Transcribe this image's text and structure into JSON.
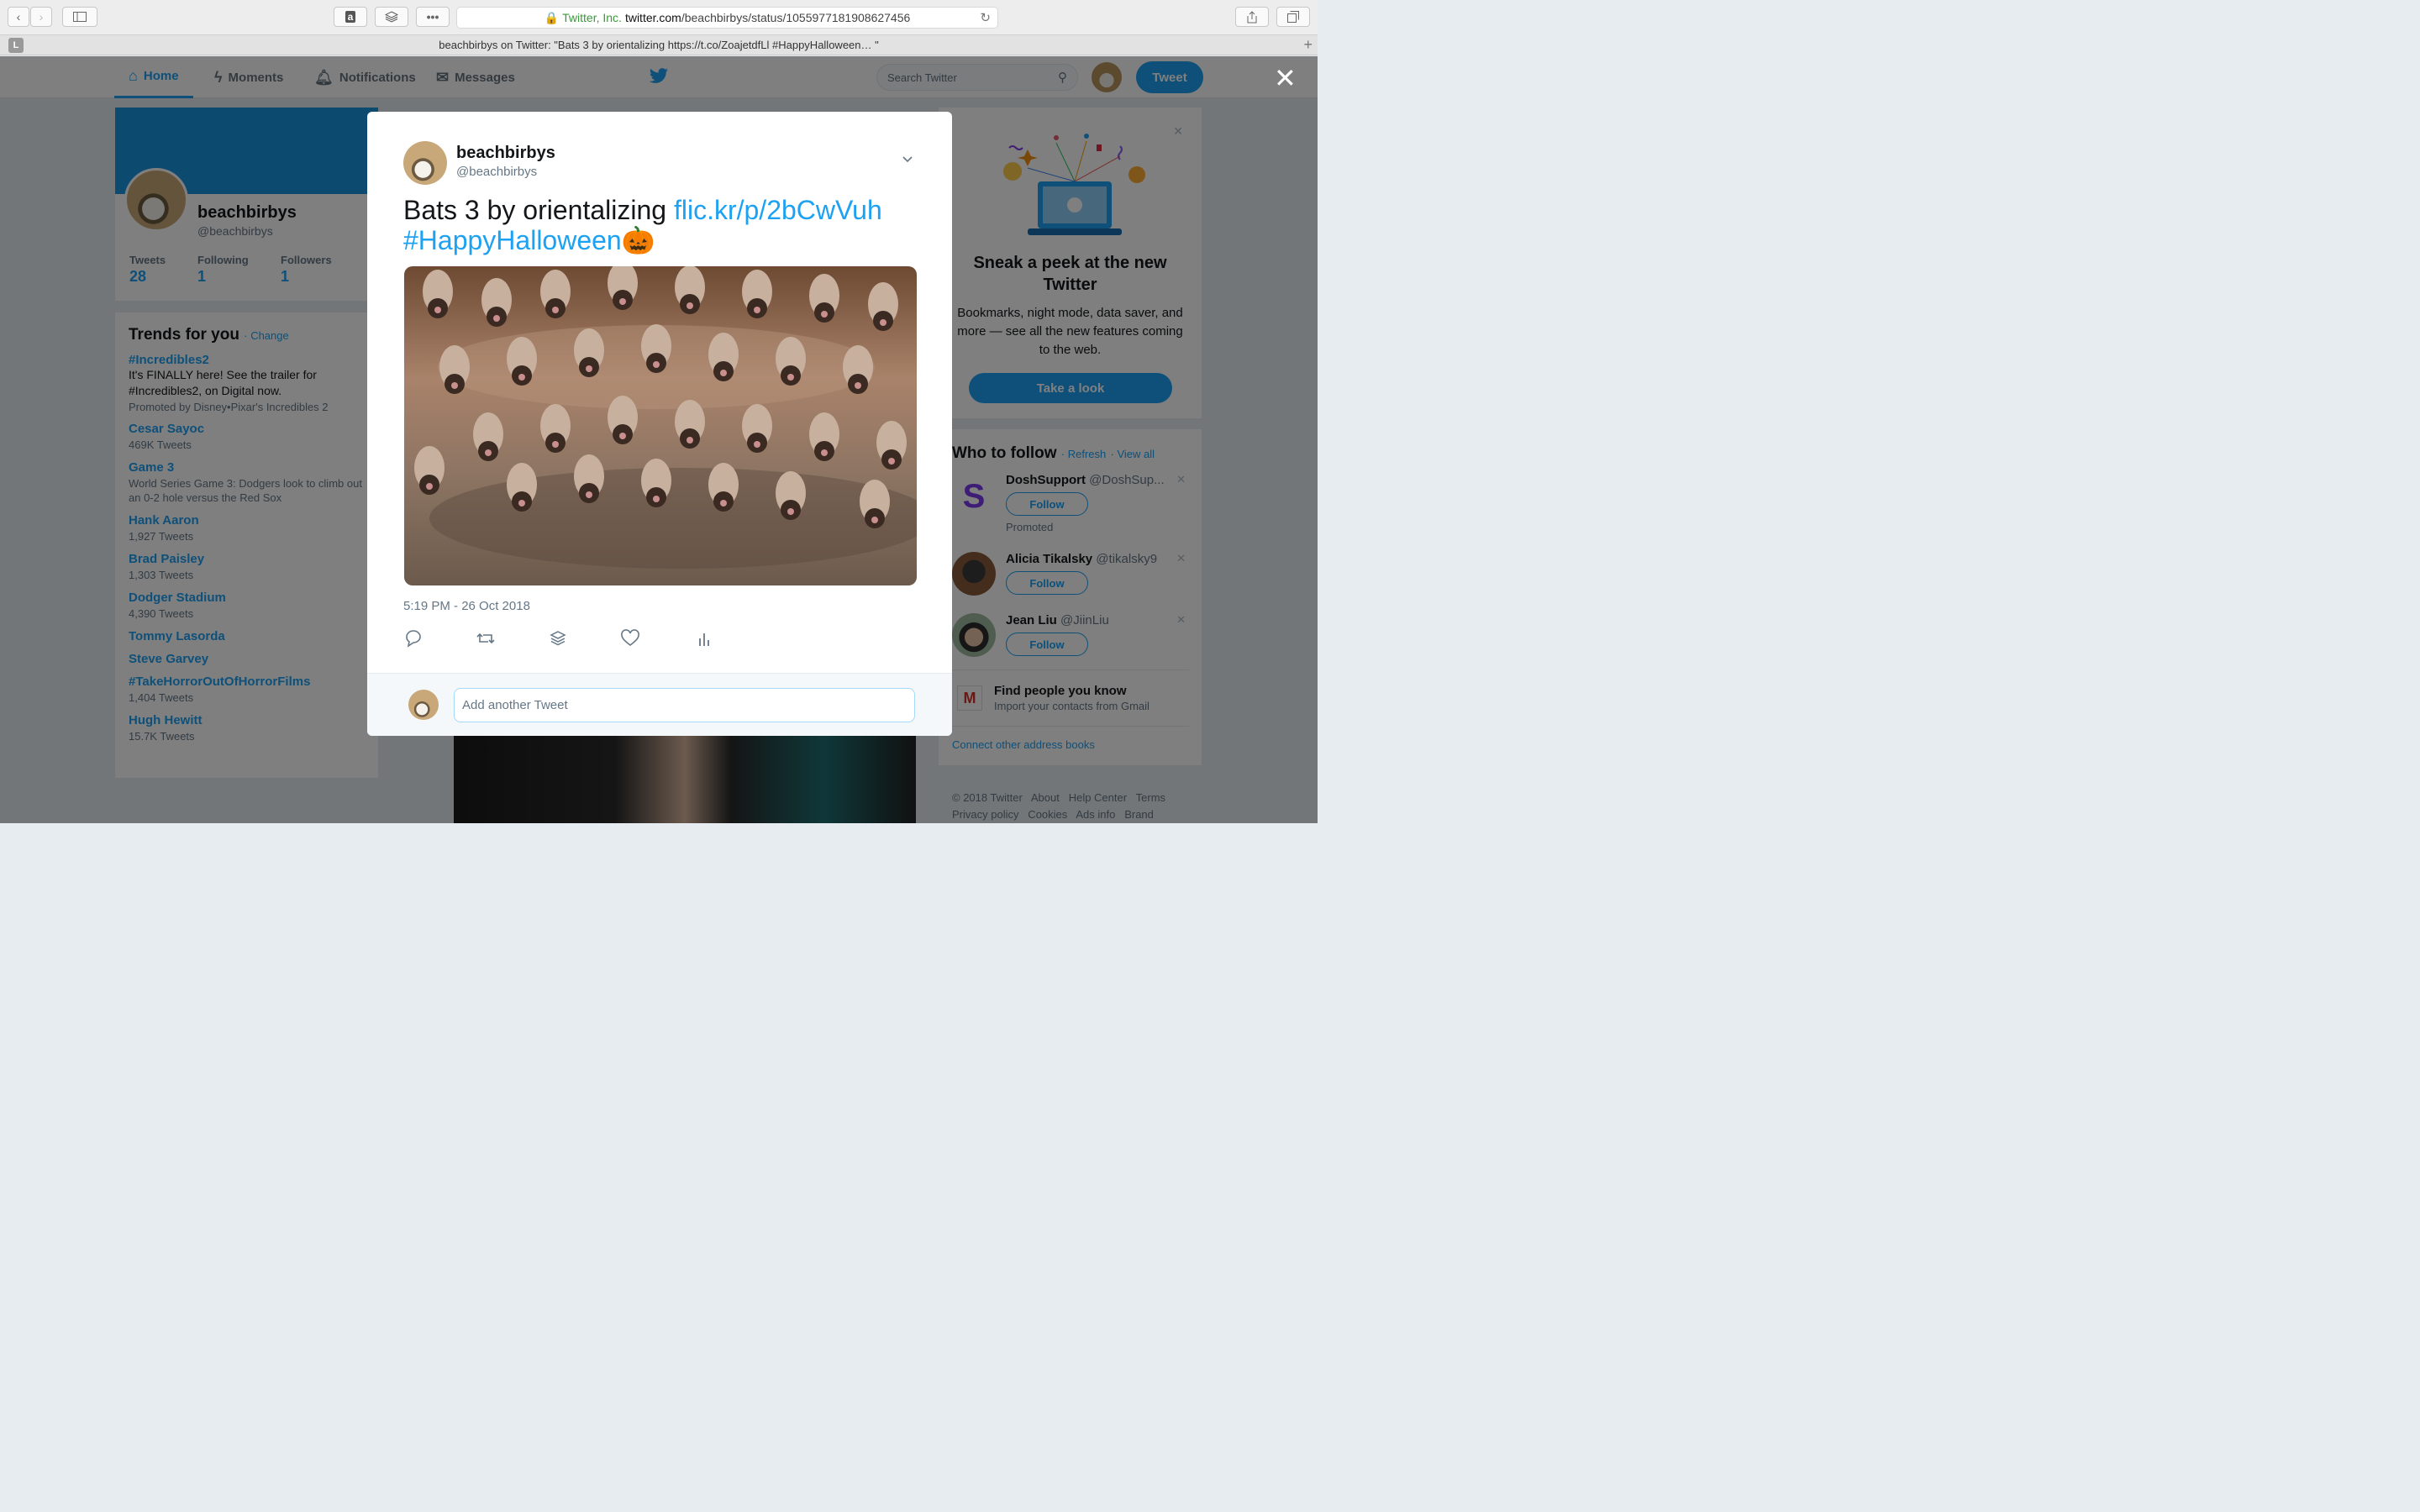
{
  "browser": {
    "url_secure_label": "Twitter, Inc.",
    "url_host": "twitter.com",
    "url_path": "/beachbirbys/status/1055977181908627456",
    "tab_title": "beachbirbys on Twitter: \"Bats 3 by orientalizing https://t.co/ZoajetdfLl #HappyHalloween… \"",
    "tab_badge": "L"
  },
  "nav": {
    "home": "Home",
    "moments": "Moments",
    "notifications": "Notifications",
    "messages": "Messages",
    "search_placeholder": "Search Twitter",
    "tweet_button": "Tweet"
  },
  "profile": {
    "name": "beachbirbys",
    "handle": "@beachbirbys",
    "stats": [
      {
        "label": "Tweets",
        "value": "28"
      },
      {
        "label": "Following",
        "value": "1"
      },
      {
        "label": "Followers",
        "value": "1"
      }
    ]
  },
  "trends": {
    "title": "Trends for you",
    "change_link": "· Change",
    "promoted": {
      "name": "#Incredibles2",
      "text": "It's FINALLY here! See the trailer for #Incredibles2, on Digital now.",
      "by": "Promoted by Disney•Pixar's Incredibles 2"
    },
    "items": [
      {
        "name": "Cesar Sayoc",
        "desc": "469K Tweets"
      },
      {
        "name": "Game 3",
        "desc": "World Series Game 3: Dodgers look to climb out an 0-2 hole versus the Red Sox"
      },
      {
        "name": "Hank Aaron",
        "desc": "1,927 Tweets"
      },
      {
        "name": "Brad Paisley",
        "desc": "1,303 Tweets"
      },
      {
        "name": "Dodger Stadium",
        "desc": "4,390 Tweets"
      },
      {
        "name": "Tommy Lasorda",
        "desc": ""
      },
      {
        "name": "Steve Garvey",
        "desc": ""
      },
      {
        "name": "#TakeHorrorOutOfHorrorFilms",
        "desc": "1,404 Tweets"
      },
      {
        "name": "Hugh Hewitt",
        "desc": "15.7K Tweets"
      }
    ]
  },
  "promo_card": {
    "title": "Sneak a peek at the new Twitter",
    "desc": "Bookmarks, night mode, data saver, and more — see all the new features coming to the web.",
    "button": "Take a look"
  },
  "who_to_follow": {
    "title": "Who to follow",
    "refresh": "· Refresh",
    "view_all": "· View all",
    "users": [
      {
        "name": "DoshSupport",
        "handle": "@DoshSup...",
        "follow": "Follow",
        "note": "Promoted"
      },
      {
        "name": "Alicia Tikalsky",
        "handle": "@tikalsky9",
        "follow": "Follow",
        "note": ""
      },
      {
        "name": "Jean Liu",
        "handle": "@JiinLiu",
        "follow": "Follow",
        "note": ""
      }
    ],
    "gmail_title": "Find people you know",
    "gmail_desc": "Import your contacts from Gmail",
    "connect_link": "Connect other address books"
  },
  "footer": {
    "line1": "© 2018 Twitter   About   Help Center   Terms",
    "line2": "Privacy policy   Cookies   Ads info   Brand"
  },
  "tweet": {
    "name": "beachbirbys",
    "handle": "@beachbirbys",
    "text_prefix": "Bats 3 by orientalizing ",
    "link": "flic.kr/p/2bCwVuh",
    "hashtag": "#HappyHalloween",
    "emoji": "🎃",
    "timestamp": "5:19 PM - 26 Oct 2018",
    "reply_placeholder": "Add another Tweet"
  },
  "colors": {
    "accent": "#1da1f2",
    "overlay": "rgba(0,0,0,0.5)"
  }
}
